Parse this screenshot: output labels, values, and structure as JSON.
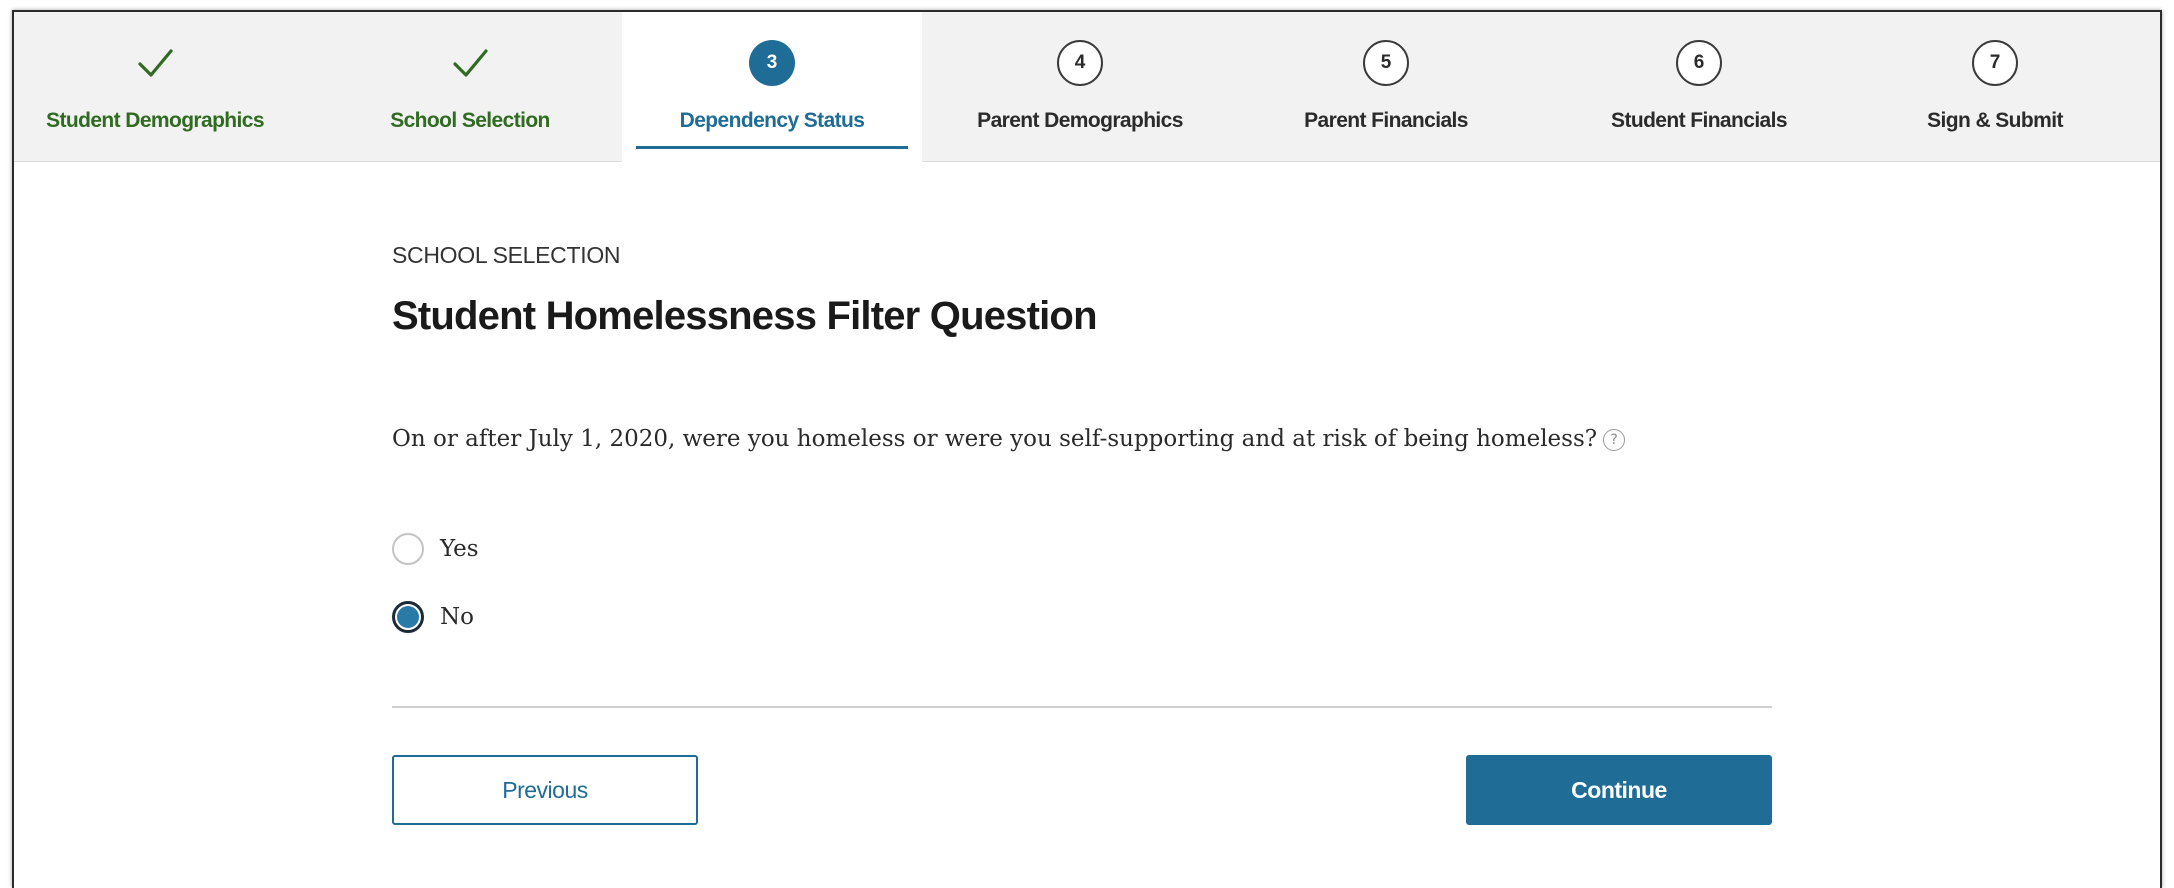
{
  "colors": {
    "accent": "#1f6d96",
    "completed": "#2f6b20",
    "nav_background": "#f2f2f2"
  },
  "steps": [
    {
      "label": "Student Demographics",
      "state": "completed",
      "icon": "checkmark-icon"
    },
    {
      "label": "School Selection",
      "state": "completed",
      "icon": "checkmark-icon"
    },
    {
      "label": "Dependency Status",
      "state": "current",
      "number": "3"
    },
    {
      "label": "Parent Demographics",
      "state": "pending",
      "number": "4"
    },
    {
      "label": "Parent Financials",
      "state": "pending",
      "number": "5"
    },
    {
      "label": "Student Financials",
      "state": "pending",
      "number": "6"
    },
    {
      "label": "Sign & Submit",
      "state": "pending",
      "number": "7"
    }
  ],
  "main": {
    "section": "SCHOOL SELECTION",
    "title": "Student Homelessness Filter Question",
    "question": "On or after July 1, 2020, were you homeless or were you self-supporting and at risk of being homeless?",
    "help_icon": "question-circle-icon",
    "help_glyph": "?",
    "options": [
      {
        "label": "Yes",
        "selected": false
      },
      {
        "label": "No",
        "selected": true
      }
    ]
  },
  "buttons": {
    "previous": "Previous",
    "continue": "Continue"
  }
}
